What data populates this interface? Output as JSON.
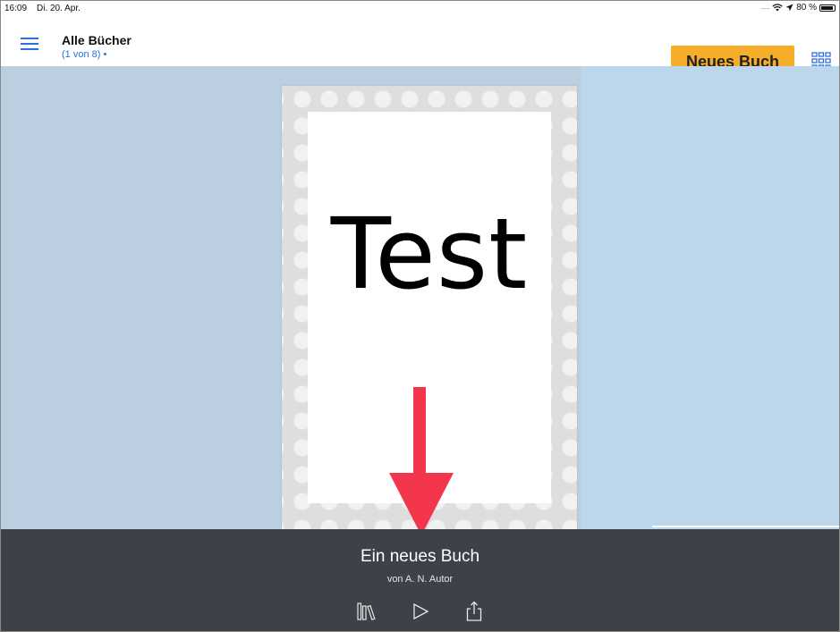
{
  "status_bar": {
    "time": "16:09",
    "date": "Di. 20. Apr.",
    "battery": "80 %",
    "icons": [
      "signal-dots-icon",
      "wifi-icon",
      "location-icon",
      "battery-icon"
    ]
  },
  "nav": {
    "title": "Alle Bücher",
    "subtitle": "(1 von 8) •",
    "new_book_label": "Neues Buch",
    "accent_color": "#2a6fe0",
    "button_color": "#f5ad2a"
  },
  "book": {
    "cover_text": "Test"
  },
  "details": {
    "title": "Ein neues Buch",
    "author": "von A. N. Autor",
    "actions": [
      "library-icon",
      "play-icon",
      "share-icon"
    ]
  }
}
